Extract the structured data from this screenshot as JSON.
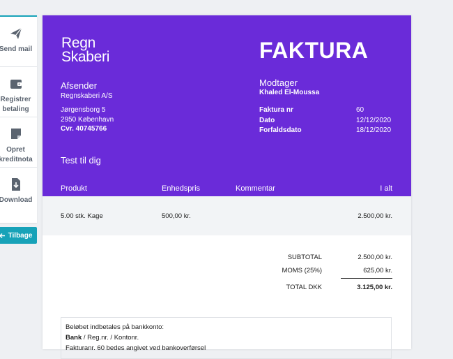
{
  "sidebar": {
    "items": [
      {
        "label": "Send mail",
        "icon": "paper-plane-icon"
      },
      {
        "label": "Registrer betaling",
        "icon": "wallet-icon"
      },
      {
        "label": "Opret kreditnota",
        "icon": "note-icon"
      },
      {
        "label": "Download",
        "icon": "download-icon"
      }
    ],
    "back_label": "Tilbage",
    "accent_color": "#17a2b8"
  },
  "invoice": {
    "brand_color": "#6a2bd9",
    "logo_line1": "Regn",
    "logo_line2": "Skaberi",
    "title": "FAKTURA",
    "sender": {
      "heading": "Afsender",
      "name": "Regnskaberi A/S",
      "street": "Jørgensborg 5",
      "city": "2950 København",
      "cvr": "Cvr. 40745766"
    },
    "receiver": {
      "heading": "Modtager",
      "name": "Khaled El-Moussa"
    },
    "meta": [
      {
        "label": "Faktura nr",
        "value": "60"
      },
      {
        "label": "Dato",
        "value": "12/12/2020"
      },
      {
        "label": "Forfaldsdato",
        "value": "18/12/2020"
      }
    ],
    "greeting": "Test til dig",
    "columns": {
      "product": "Produkt",
      "unit_price": "Enhedspris",
      "comment": "Kommentar",
      "total": "I alt"
    },
    "lines": [
      {
        "product": "5.00 stk. Kage",
        "unit_price": "500,00 kr.",
        "comment": "",
        "total": "2.500,00 kr."
      }
    ],
    "totals": {
      "subtotal_label": "SUBTOTAL",
      "subtotal_value": "2.500,00 kr.",
      "vat_label": "MOMS (25%)",
      "vat_value": "625,00 kr.",
      "total_label": "TOTAL DKK",
      "total_value": "3.125,00 kr."
    },
    "payment": {
      "intro": "Beløbet indbetales på bankkonto:",
      "bank_bold": "Bank",
      "bank_rest": " / Reg.nr. / Kontonr.",
      "note": "Fakturanr. 60 bedes angivet ved bankoverførsel"
    }
  }
}
